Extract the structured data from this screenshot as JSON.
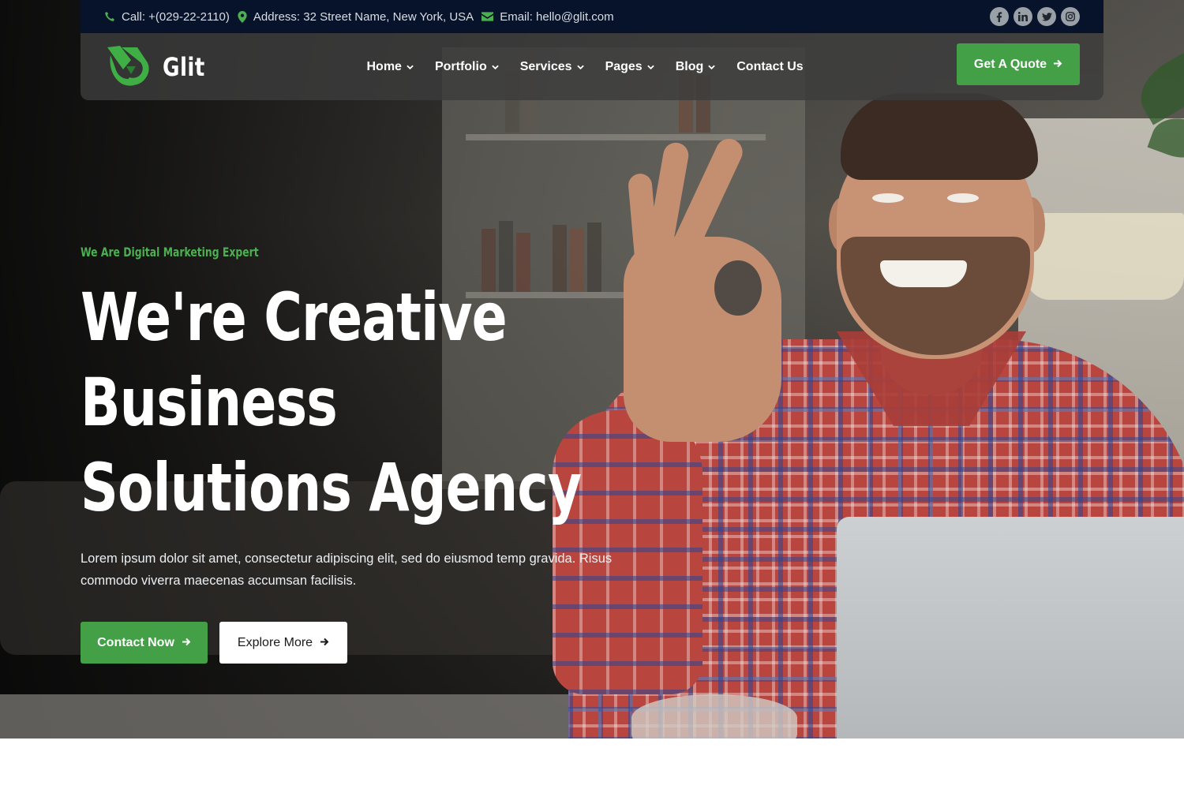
{
  "topbar": {
    "phone": "Call: +(029-22-2110)",
    "address": "Address: 32 Street Name, New York, USA",
    "email": "Email: hello@glit.com",
    "socials": [
      "facebook-icon",
      "linkedin-icon",
      "twitter-icon",
      "instagram-icon"
    ]
  },
  "navbar": {
    "logo_text": "Glit",
    "menu": [
      {
        "label": "Home",
        "has_dropdown": true
      },
      {
        "label": "Portfolio",
        "has_dropdown": true
      },
      {
        "label": "Services",
        "has_dropdown": true
      },
      {
        "label": "Pages",
        "has_dropdown": true
      },
      {
        "label": "Blog",
        "has_dropdown": true
      },
      {
        "label": "Contact Us",
        "has_dropdown": false
      }
    ],
    "quote_button": "Get A Quote"
  },
  "hero": {
    "eyebrow": "We Are Digital Marketing Expert",
    "headline_line1": "We're Creative Business",
    "headline_line2": "Solutions Agency",
    "description": "Lorem ipsum dolor sit amet, consectetur adipiscing elit, sed do eiusmod temp gravida. Risus commodo viverra maecenas accumsan facilisis.",
    "primary_button": "Contact Now",
    "secondary_button": "Explore More"
  },
  "colors": {
    "accent": "#43a047",
    "topbar_bg": "#06132a",
    "text_light": "#ffffff"
  }
}
